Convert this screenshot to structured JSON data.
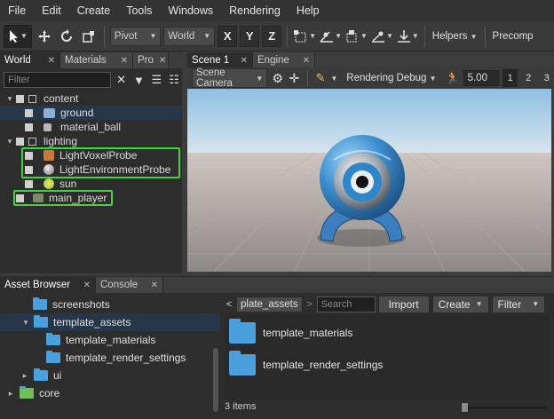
{
  "menu": [
    "File",
    "Edit",
    "Create",
    "Tools",
    "Windows",
    "Rendering",
    "Help"
  ],
  "toolbar": {
    "pivot": "Pivot",
    "space": "World",
    "axes": [
      "X",
      "Y",
      "Z"
    ],
    "helpers": "Helpers",
    "precomp": "Precomp"
  },
  "world_panel": {
    "tabs": [
      "World",
      "Materials",
      "Pro"
    ],
    "filter_placeholder": "Filter",
    "tree": [
      {
        "label": "content",
        "level": 0,
        "arrow": "▾",
        "icon": "node-icon"
      },
      {
        "label": "ground",
        "level": 1,
        "arrow": "",
        "icon": "mesh-icon",
        "selected": true
      },
      {
        "label": "material_ball",
        "level": 1,
        "arrow": "",
        "icon": "mesh-icon"
      },
      {
        "label": "lighting",
        "level": 0,
        "arrow": "▾",
        "icon": "node-icon"
      },
      {
        "label": "LightVoxelProbe",
        "level": 1,
        "arrow": "",
        "icon": "voxel-probe-icon"
      },
      {
        "label": "LightEnvironmentProbe",
        "level": 1,
        "arrow": "",
        "icon": "environment-probe-icon"
      },
      {
        "label": "sun",
        "level": 1,
        "arrow": "",
        "icon": "sun-icon"
      },
      {
        "label": "main_player",
        "level": 0,
        "arrow": "",
        "icon": "player-icon"
      }
    ]
  },
  "scene_panel": {
    "tabs": [
      "Scene 1",
      "Engine"
    ],
    "camera": "Scene Camera",
    "rendering_debug": "Rendering Debug",
    "speed": "5.00",
    "views": [
      "1",
      "2",
      "3"
    ]
  },
  "bottom_tabs": [
    "Asset Browser",
    "Console"
  ],
  "asset_browser": {
    "tree": [
      {
        "label": "screenshots",
        "arrow": ""
      },
      {
        "label": "template_assets",
        "arrow": "▾",
        "selected": true
      },
      {
        "label": "template_materials",
        "arrow": ""
      },
      {
        "label": "template_render_settings",
        "arrow": ""
      },
      {
        "label": "ui",
        "arrow": "▸"
      },
      {
        "label": "core",
        "arrow": "▸"
      }
    ],
    "breadcrumb": "plate_assets",
    "search_placeholder": "Search",
    "import_label": "Import",
    "create_label": "Create",
    "filter_label": "Filter",
    "items": [
      "template_materials",
      "template_render_settings"
    ],
    "status": "3 items"
  }
}
